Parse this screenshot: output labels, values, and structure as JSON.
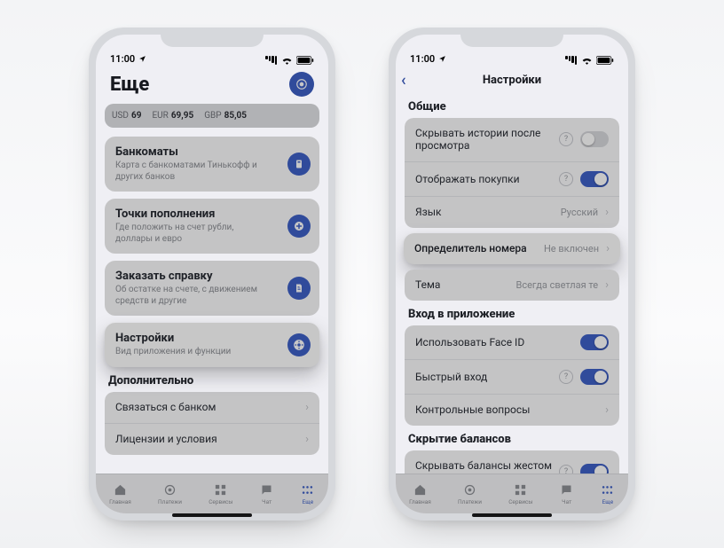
{
  "status": {
    "time": "11:00"
  },
  "left": {
    "header": {
      "title": "Еще"
    },
    "rates": [
      {
        "code": "USD",
        "value": "69"
      },
      {
        "code": "EUR",
        "value": "69,95"
      },
      {
        "code": "GBP",
        "value": "85,05"
      }
    ],
    "cards": {
      "atm": {
        "title": "Банкоматы",
        "sub": "Карта с банкоматами Тинькофф и других банков"
      },
      "topup": {
        "title": "Точки пополнения",
        "sub": "Где положить на счет рубли, доллары и евро"
      },
      "stmt": {
        "title": "Заказать справку",
        "sub": "Об остатке на счете, с движением средств и другие"
      },
      "settings": {
        "title": "Настройки",
        "sub": "Вид приложения и функции"
      }
    },
    "additional": {
      "title": "Дополнительно",
      "rows": {
        "bank": "Связаться с банком",
        "terms": "Лицензии и условия"
      }
    }
  },
  "right": {
    "navTitle": "Настройки",
    "sections": {
      "general": {
        "title": "Общие",
        "hideStories": "Скрывать истории после просмотра",
        "showBuys": "Отображать покупки",
        "language": {
          "label": "Язык",
          "value": "Русский"
        },
        "callerId": {
          "label": "Определитель номера",
          "value": "Не включен"
        },
        "theme": {
          "label": "Тема",
          "value": "Всегда светлая те"
        }
      },
      "login": {
        "title": "Вход в приложение",
        "faceid": "Использовать Face ID",
        "quick": "Быстрый вход",
        "secq": "Контрольные вопросы"
      },
      "balance": {
        "title": "Скрытие балансов",
        "flip": "Скрывать балансы жестом переворота"
      }
    }
  },
  "tabs": {
    "home": "Главная",
    "pay": "Платежи",
    "serv": "Сервисы",
    "chat": "Чат",
    "more": "Еще"
  }
}
